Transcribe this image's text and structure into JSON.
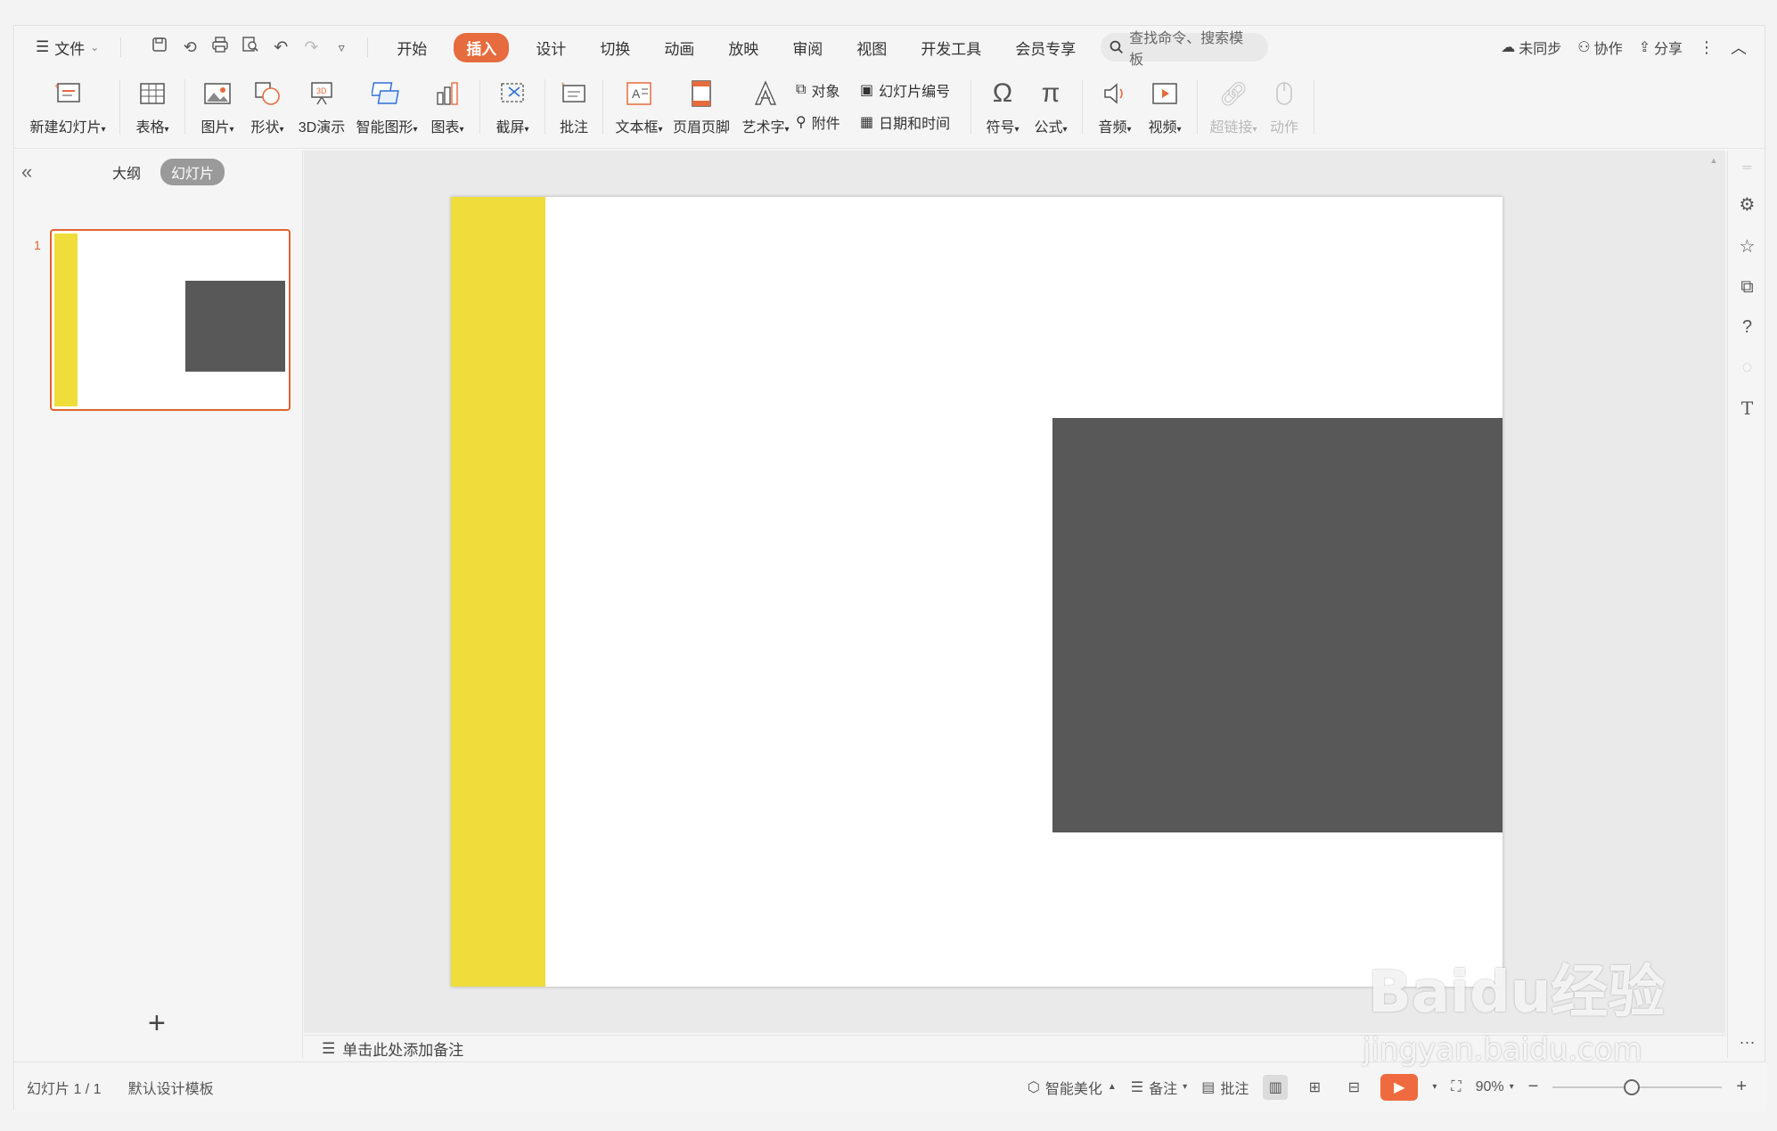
{
  "menubar": {
    "file_label": "文件",
    "tabs": [
      "开始",
      "插入",
      "设计",
      "切换",
      "动画",
      "放映",
      "审阅",
      "视图",
      "开发工具",
      "会员专享"
    ],
    "active_tab_index": 1,
    "search_placeholder": "查找命令、搜索模板",
    "right": {
      "sync": "未同步",
      "collab": "协作",
      "share": "分享"
    }
  },
  "ribbon": {
    "new_slide": "新建幻灯片",
    "table": "表格",
    "picture": "图片",
    "shape": "形状",
    "three_d": "3D演示",
    "smartart": "智能图形",
    "chart": "图表",
    "screenshot": "截屏",
    "comment": "批注",
    "textbox": "文本框",
    "header_footer": "页眉页脚",
    "wordart": "艺术字",
    "object": "对象",
    "attachment": "附件",
    "slide_number": "幻灯片编号",
    "datetime": "日期和时间",
    "symbol": "符号",
    "formula": "公式",
    "audio": "音频",
    "video": "视频",
    "hyperlink": "超链接",
    "action": "动作"
  },
  "left_panel": {
    "tab_outline": "大纲",
    "tab_slides": "幻灯片",
    "slide_number": "1"
  },
  "colors": {
    "yellow_bar": "#eedd3a",
    "dark_rect": "#585858",
    "accent": "#e66b3e"
  },
  "notes": {
    "placeholder": "单击此处添加备注"
  },
  "status": {
    "slide_info": "幻灯片 1 / 1",
    "template": "默认设计模板",
    "beautify": "智能美化",
    "notes": "备注",
    "comment": "批注",
    "zoom": "90%"
  },
  "watermark": {
    "brand": "Baidu经验",
    "url": "jingyan.baidu.com"
  }
}
